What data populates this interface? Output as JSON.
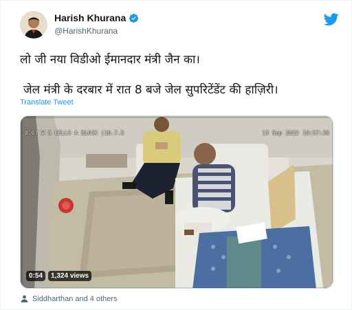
{
  "author": {
    "display_name": "Harish Khurana",
    "handle": "@HarishKhurana",
    "verified": true,
    "avatar_icon": "profile-photo"
  },
  "tweet": {
    "text_line1": "लो जी नया विडीओ ईमानदार मंत्री जैन का।",
    "text_line2": "जेल मंत्री के दरबार में रात 8 बजे जेल सुपरिटेंडेंट की हाज़िरी।",
    "translate_label": "Translate Tweet"
  },
  "media": {
    "overlay_left": "0.07 W 5 CELLS A BLOCK (10.7.5",
    "overlay_date": "13 Sep 2022",
    "overlay_time": "19:57:38",
    "duration": "0:54",
    "views": "1,324 views"
  },
  "likes": {
    "icon": "person-icon",
    "text": "Siddharthan and 4 others"
  },
  "colors": {
    "accent": "#1d9bf0",
    "text": "#0f1419",
    "muted": "#536471"
  }
}
